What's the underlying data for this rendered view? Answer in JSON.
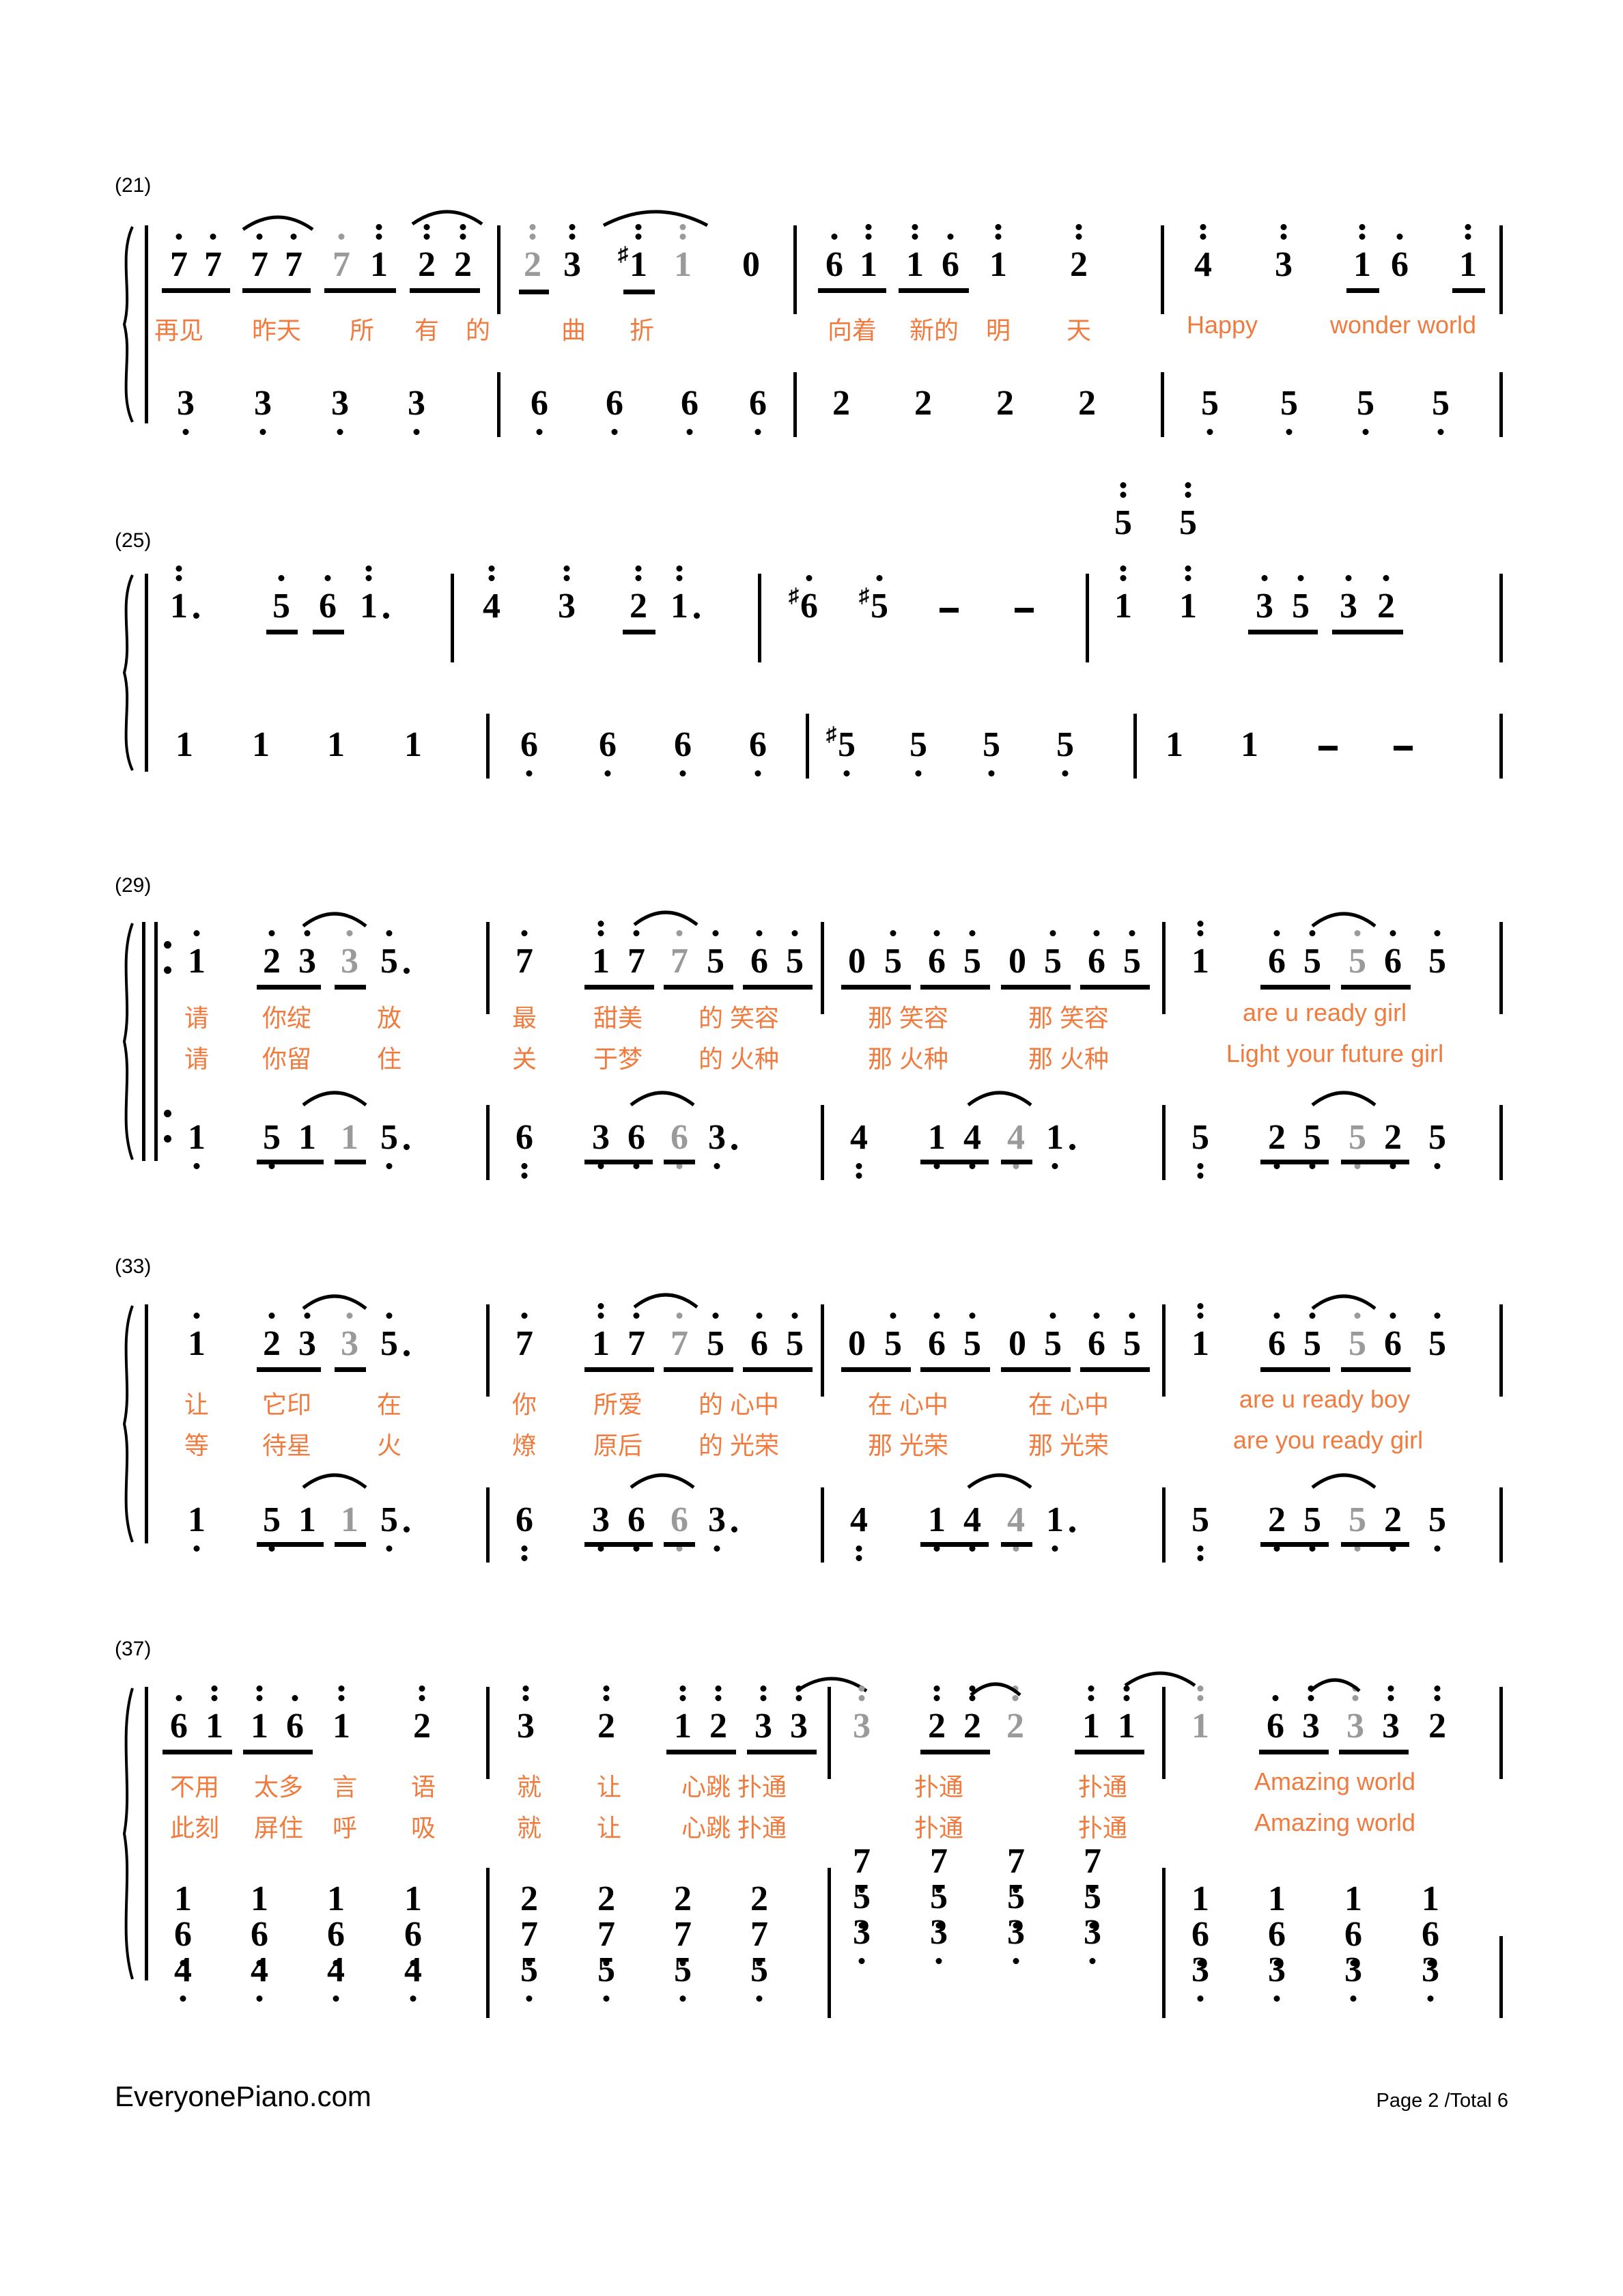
{
  "page": {
    "site_name": "EveryonePiano.com",
    "page_label": "Page 2 /Total 6",
    "lyric_color": "#F07B3F",
    "ghost_note_color": "#9a9a9a",
    "note_color": "#000000"
  },
  "systems": [
    {
      "measure_number": "(21)",
      "melody": [
        {
          "measure": 21,
          "notes": "7 7 7 7 7 1 2 2",
          "rendered": [
            "7",
            "7",
            "7",
            "7",
            "7",
            "1",
            "2",
            "2"
          ]
        },
        {
          "measure": 22,
          "notes": "2 3 #1 1 0",
          "rendered": [
            "2",
            "3",
            "1",
            "1",
            "0"
          ]
        },
        {
          "measure": 23,
          "notes": "6 1 1 6 1 2",
          "rendered": [
            "6",
            "1",
            "1",
            "6",
            "1",
            "2"
          ]
        },
        {
          "measure": 24,
          "notes": "4 3 1 6 1",
          "rendered": [
            "4",
            "3",
            "1",
            "6",
            "1"
          ]
        }
      ],
      "lyrics_line1": [
        "再见",
        "昨天",
        "所",
        "有",
        "的",
        "曲",
        "折",
        "向着",
        "新的",
        "明",
        "天",
        "Happy",
        "wonder world"
      ],
      "bass": [
        {
          "measure": 21,
          "notes": [
            "3",
            "3",
            "3",
            "3"
          ]
        },
        {
          "measure": 22,
          "notes": [
            "6",
            "6",
            "6",
            "6"
          ]
        },
        {
          "measure": 23,
          "notes": [
            "2",
            "2",
            "2",
            "2"
          ]
        },
        {
          "measure": 24,
          "notes": [
            "5",
            "5",
            "5",
            "5"
          ]
        }
      ]
    },
    {
      "measure_number": "(25)",
      "melody": [
        {
          "measure": 25,
          "notes": "1. 5 6 1.",
          "rendered": [
            "1",
            "5",
            "6",
            "1"
          ]
        },
        {
          "measure": 26,
          "notes": "4 3 2 1.",
          "rendered": [
            "4",
            "3",
            "2",
            "1"
          ]
        },
        {
          "measure": 27,
          "notes": "#6 #5 - -",
          "rendered": [
            "6",
            "5",
            "-",
            "-"
          ]
        },
        {
          "measure": 28,
          "notes": "5/1 5/1 3 5 3 2",
          "rendered": [
            "5",
            "5",
            "1",
            "1",
            "3",
            "5",
            "3",
            "2"
          ]
        }
      ],
      "lyrics_line1": [],
      "bass": [
        {
          "measure": 25,
          "notes": [
            "1",
            "1",
            "1",
            "1"
          ]
        },
        {
          "measure": 26,
          "notes": [
            "6",
            "6",
            "6",
            "6"
          ]
        },
        {
          "measure": 27,
          "notes": [
            "#5",
            "5",
            "5",
            "5"
          ]
        },
        {
          "measure": 28,
          "notes": [
            "1",
            "1",
            "-",
            "-"
          ]
        }
      ]
    },
    {
      "measure_number": "(29)",
      "repeat_start": true,
      "melody": [
        {
          "measure": 29,
          "notes": "1 2 3 3 5.",
          "rendered": [
            "1",
            "2",
            "3",
            "3",
            "5"
          ]
        },
        {
          "measure": 30,
          "notes": "7 1 7 7 5 6 5",
          "rendered": [
            "7",
            "1",
            "7",
            "7",
            "5",
            "6",
            "5"
          ]
        },
        {
          "measure": 31,
          "notes": "0 5 6 5 0 5 6 5",
          "rendered": [
            "0",
            "5",
            "6",
            "5",
            "0",
            "5",
            "6",
            "5"
          ]
        },
        {
          "measure": 32,
          "notes": "1 6 5 5 6 5",
          "rendered": [
            "1",
            "6",
            "5",
            "5",
            "6",
            "5"
          ]
        }
      ],
      "lyrics_line1": [
        "请",
        "你绽",
        "放",
        "最",
        "甜美",
        "的 笑容",
        "那 笑容",
        "那 笑容",
        "are  u  ready  girl"
      ],
      "lyrics_line2": [
        "请",
        "你留",
        "住",
        "关",
        "于梦",
        "的 火种",
        "那 火种",
        "那 火种",
        "Light your future girl"
      ],
      "bass": [
        {
          "measure": 29,
          "notes": [
            "1",
            "5",
            "1",
            "1",
            "5."
          ]
        },
        {
          "measure": 30,
          "notes": [
            "6",
            "3",
            "6",
            "6",
            "3."
          ]
        },
        {
          "measure": 31,
          "notes": [
            "4",
            "1",
            "4",
            "4",
            "1."
          ]
        },
        {
          "measure": 32,
          "notes": [
            "5",
            "2",
            "5",
            "5",
            "2",
            "5"
          ]
        }
      ]
    },
    {
      "measure_number": "(33)",
      "melody": [
        {
          "measure": 33,
          "notes": "1 2 3 3 5.",
          "rendered": [
            "1",
            "2",
            "3",
            "3",
            "5"
          ]
        },
        {
          "measure": 34,
          "notes": "7 1 7 7 5 6 5",
          "rendered": [
            "7",
            "1",
            "7",
            "7",
            "5",
            "6",
            "5"
          ]
        },
        {
          "measure": 35,
          "notes": "0 5 6 5 0 5 6 5",
          "rendered": [
            "0",
            "5",
            "6",
            "5",
            "0",
            "5",
            "6",
            "5"
          ]
        },
        {
          "measure": 36,
          "notes": "1 6 5 5 6 5",
          "rendered": [
            "1",
            "6",
            "5",
            "5",
            "6",
            "5"
          ]
        }
      ],
      "lyrics_line1": [
        "让",
        "它印",
        "在",
        "你",
        "所爱",
        "的 心中",
        "在 心中",
        "在 心中",
        "are  u  ready  boy"
      ],
      "lyrics_line2": [
        "等",
        "待星",
        "火",
        "燎",
        "原后",
        "的 光荣",
        "那 光荣",
        "那 光荣",
        "are  you  ready girl"
      ],
      "bass": [
        {
          "measure": 33,
          "notes": [
            "1",
            "5",
            "1",
            "1",
            "5."
          ]
        },
        {
          "measure": 34,
          "notes": [
            "6",
            "3",
            "6",
            "6",
            "3."
          ]
        },
        {
          "measure": 35,
          "notes": [
            "4",
            "1",
            "4",
            "4",
            "1."
          ]
        },
        {
          "measure": 36,
          "notes": [
            "5",
            "2",
            "5",
            "5",
            "2",
            "5"
          ]
        }
      ]
    },
    {
      "measure_number": "(37)",
      "melody": [
        {
          "measure": 37,
          "notes": "6 1 1 6 1 2",
          "rendered": [
            "6",
            "1",
            "1",
            "6",
            "1",
            "2"
          ]
        },
        {
          "measure": 38,
          "notes": "3 2 1 2 3 3",
          "rendered": [
            "3",
            "2",
            "1",
            "2",
            "3",
            "3"
          ]
        },
        {
          "measure": 39,
          "notes": "3 2 2 2 1 1",
          "rendered": [
            "3",
            "2",
            "2",
            "2",
            "1",
            "1"
          ]
        },
        {
          "measure": 40,
          "notes": "1 6 3 3 3 2",
          "rendered": [
            "1",
            "6",
            "3",
            "3",
            "3",
            "2"
          ]
        }
      ],
      "lyrics_line1": [
        "不用",
        "太多",
        "言",
        "语",
        "就",
        "让",
        "心跳 扑通",
        "扑通",
        "扑通",
        "Amazing world"
      ],
      "lyrics_line2": [
        "此刻",
        "屏住",
        "呼",
        "吸",
        "就",
        "让",
        "心跳 扑通",
        "扑通",
        "扑通",
        "Amazing world"
      ],
      "bass_chords": [
        {
          "measure": 37,
          "chords": [
            [
              "1",
              "6",
              "4"
            ],
            [
              "1",
              "6",
              "4"
            ],
            [
              "1",
              "6",
              "4"
            ],
            [
              "1",
              "6",
              "4"
            ]
          ]
        },
        {
          "measure": 38,
          "chords": [
            [
              "2",
              "7",
              "5"
            ],
            [
              "2",
              "7",
              "5"
            ],
            [
              "2",
              "7",
              "5"
            ],
            [
              "2",
              "7",
              "5"
            ]
          ]
        },
        {
          "measure": 39,
          "chords": [
            [
              "7",
              "5",
              "3"
            ],
            [
              "7",
              "5",
              "3"
            ],
            [
              "7",
              "5",
              "3"
            ],
            [
              "7",
              "5",
              "3"
            ]
          ]
        },
        {
          "measure": 40,
          "chords": [
            [
              "1",
              "6",
              "3"
            ],
            [
              "1",
              "6",
              "3"
            ],
            [
              "1",
              "6",
              "3"
            ],
            [
              "1",
              "6",
              "3"
            ]
          ]
        }
      ]
    }
  ],
  "chart_data": {
    "type": "table",
    "title": "Numbered musical notation (jianpu) piano score - page 2",
    "measures_shown": [
      "21",
      "25",
      "29",
      "33",
      "37"
    ],
    "systems": 5
  }
}
